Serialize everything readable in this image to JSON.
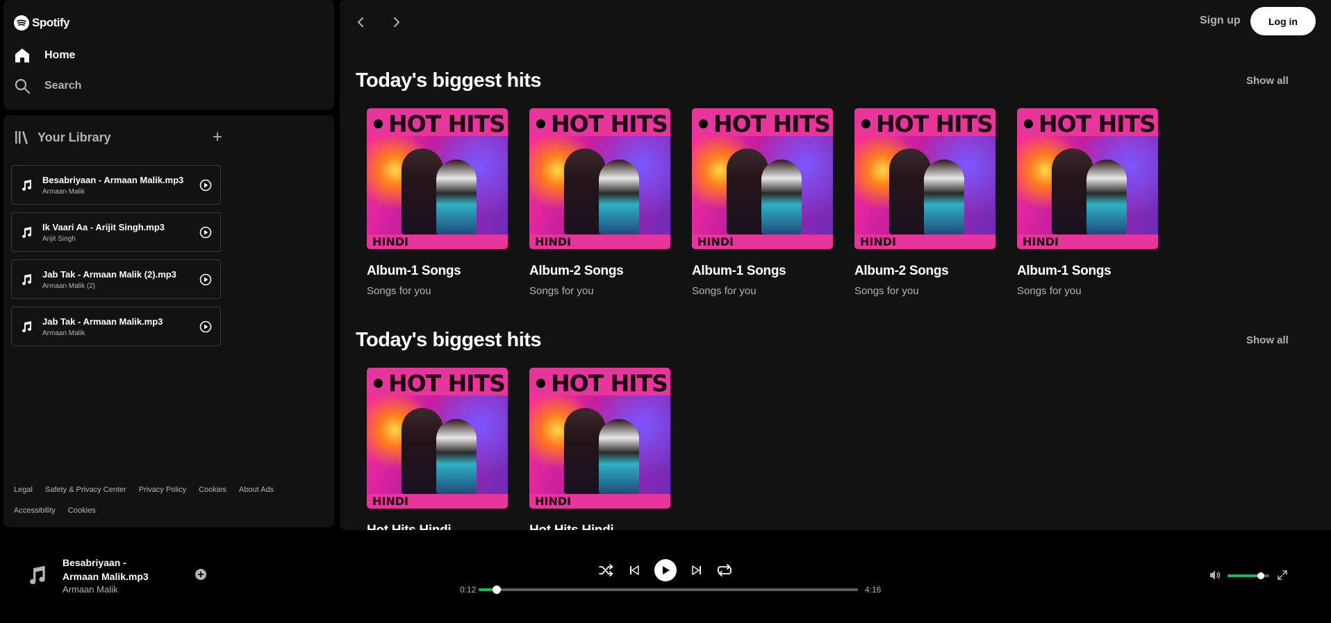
{
  "brand": {
    "name": "Spotify",
    "accent_color": "#1db954"
  },
  "nav": {
    "home_label": "Home",
    "search_label": "Search"
  },
  "library": {
    "title": "Your Library",
    "add_label": "+",
    "tracks": [
      {
        "title": "Besabriyaan - Armaan Malik.mp3",
        "artist": "Armaan Malik"
      },
      {
        "title": "Ik Vaari Aa - Arijit Singh.mp3",
        "artist": "Arijit Singh"
      },
      {
        "title": "Jab Tak - Armaan Malik (2).mp3",
        "artist": "Armaan Malik (2)"
      },
      {
        "title": "Jab Tak - Armaan Malik.mp3",
        "artist": "Armaan Malik"
      }
    ],
    "footer_links": [
      "Legal",
      "Safety & Privacy Center",
      "Privacy Policy",
      "Cookies",
      "About Ads",
      "Accessibility",
      "Cookies"
    ]
  },
  "header": {
    "signup_label": "Sign up",
    "login_label": "Log in"
  },
  "cover": {
    "top_text": "HOT HITS",
    "band_text": "HINDI"
  },
  "sections": [
    {
      "title": "Today's biggest hits",
      "show_all": "Show all",
      "cards": [
        {
          "name": "Album-1 Songs",
          "subtitle": "Songs for you"
        },
        {
          "name": "Album-2 Songs",
          "subtitle": "Songs for you"
        },
        {
          "name": "Album-1 Songs",
          "subtitle": "Songs for you"
        },
        {
          "name": "Album-2 Songs",
          "subtitle": "Songs for you"
        },
        {
          "name": "Album-1 Songs",
          "subtitle": "Songs for you"
        }
      ]
    },
    {
      "title": "Today's biggest hits",
      "show_all": "Show all",
      "cards": [
        {
          "name": "Hot Hits Hindi",
          "subtitle": ""
        },
        {
          "name": "Hot Hits Hindi",
          "subtitle": ""
        }
      ]
    }
  ],
  "player": {
    "title": "Besabriyaan - Armaan Malik.mp3",
    "artist": "Armaan Malik",
    "elapsed": "0:12",
    "duration": "4:16",
    "progress_fraction": 0.047,
    "volume_fraction": 0.8
  }
}
